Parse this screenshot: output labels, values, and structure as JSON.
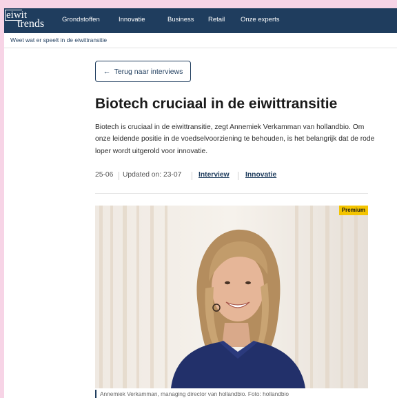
{
  "header": {
    "logo_line1": "eiwit",
    "logo_line2": "trends",
    "nav": [
      "Grondstoffen",
      "Innovatie",
      "Business",
      "Retail",
      "Onze experts"
    ]
  },
  "subbar": {
    "tagline": "Weet wat er speelt in de eiwittransitie"
  },
  "article": {
    "back_label": "Terug naar interviews",
    "title": "Biotech cruciaal in de eiwittransitie",
    "lead": "Biotech is cruciaal in de eiwittransitie, zegt Annemiek Verkamman van hollandbio. Om onze leidende positie in de voedselvoorziening te behouden, is het belangrijk dat de rode loper wordt uitgerold voor innovatie.",
    "date": "25-06",
    "updated": "Updated on: 23-07",
    "tags": [
      "Interview",
      "Innovatie"
    ],
    "badge": "Premium",
    "caption": "Annemiek Verkamman, managing director van hollandbio. Foto: hollandbio"
  },
  "colors": {
    "navy": "#1f3d5e",
    "badge": "#f4c400",
    "page_bg": "#f7d4e6"
  }
}
